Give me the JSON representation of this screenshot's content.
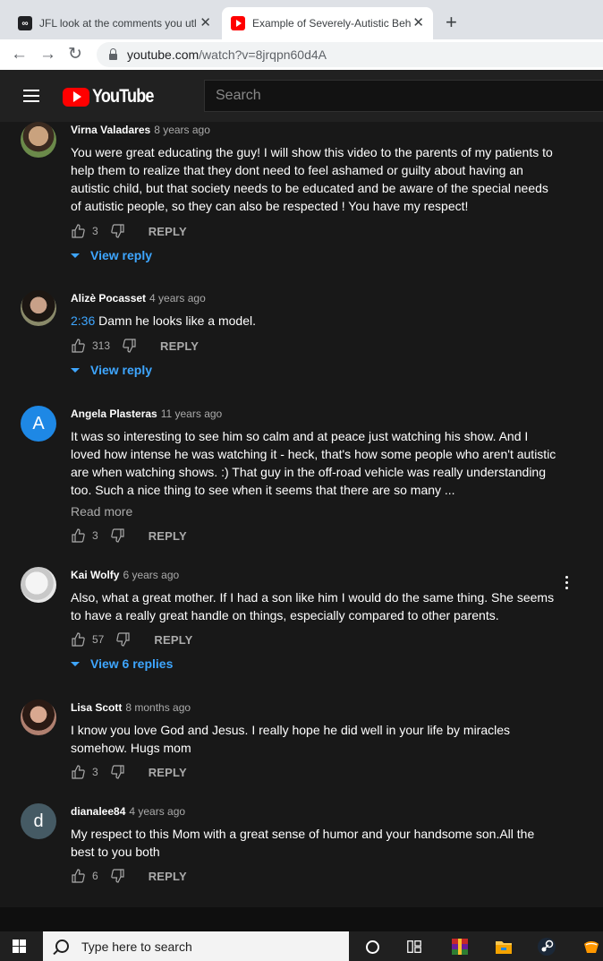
{
  "browser": {
    "tabs": [
      {
        "title": "JFL look at the comments you utl",
        "favicon": "infinity-icon",
        "close": "✕"
      },
      {
        "title": "Example of Severely-Autistic Beh",
        "favicon": "youtube-icon",
        "close": "✕"
      }
    ],
    "new_tab": "+",
    "url_host": "youtube.com",
    "url_path": "/watch?v=8jrqpn60d4A"
  },
  "youtube": {
    "logo_text": "YouTube",
    "search_placeholder": "Search"
  },
  "comments": [
    {
      "author": "Virna Valadares",
      "time": "8 years ago",
      "text": "You were great educating the guy! I will show this video to the parents of my patients to help them to realize that they dont need to feel ashamed or guilty about having an autistic child, but that society needs to be educated and be aware of the special needs of autistic people, so they can also be respected ! You have my respect!",
      "likes": "3",
      "reply_label": "REPLY",
      "view_replies": "View reply",
      "avatar_color": "#4a6b3a"
    },
    {
      "author": "Alizè Pocasset",
      "time": "4 years ago",
      "timestamp_link": "2:36",
      "text": " Damn he looks like a model.",
      "likes": "313",
      "reply_label": "REPLY",
      "view_replies": "View reply",
      "avatar_color": "#5a5a4a"
    },
    {
      "author": "Angela Plasteras",
      "time": "11 years ago",
      "avatar_letter": "A",
      "text": "It was so interesting to see him so calm and at peace just watching his show.  And I loved how intense he was watching it - heck, that's how some people who aren't autistic are when watching shows. :)  That guy in the off-road vehicle was really understanding too.  Such a nice thing to see when it seems that there are so many ...",
      "read_more": "Read more",
      "likes": "3",
      "reply_label": "REPLY",
      "avatar_color": "#1e88e5"
    },
    {
      "author": "Kai Wolfy",
      "time": "6 years ago",
      "text": "Also, what a great mother. If I had a son like him I would do the same thing. She seems to have a really great handle on things, especially compared to other parents.",
      "likes": "57",
      "reply_label": "REPLY",
      "view_replies": "View 6 replies",
      "avatar_color": "#dcdcdc"
    },
    {
      "author": "Lisa Scott",
      "time": "8 months ago",
      "text": "I know you love God and Jesus. I really hope he did well in your life by miracles somehow. Hugs mom",
      "likes": "3",
      "reply_label": "REPLY",
      "avatar_color": "#8a5a4a"
    },
    {
      "author": "dianalee84",
      "time": "4 years ago",
      "avatar_letter": "d",
      "text": "My respect to this Mom with a great sense of humor and your handsome son.All the best to you both",
      "likes": "6",
      "reply_label": "REPLY",
      "avatar_color": "#455a64"
    }
  ],
  "taskbar": {
    "search_placeholder": "Type here to search"
  }
}
